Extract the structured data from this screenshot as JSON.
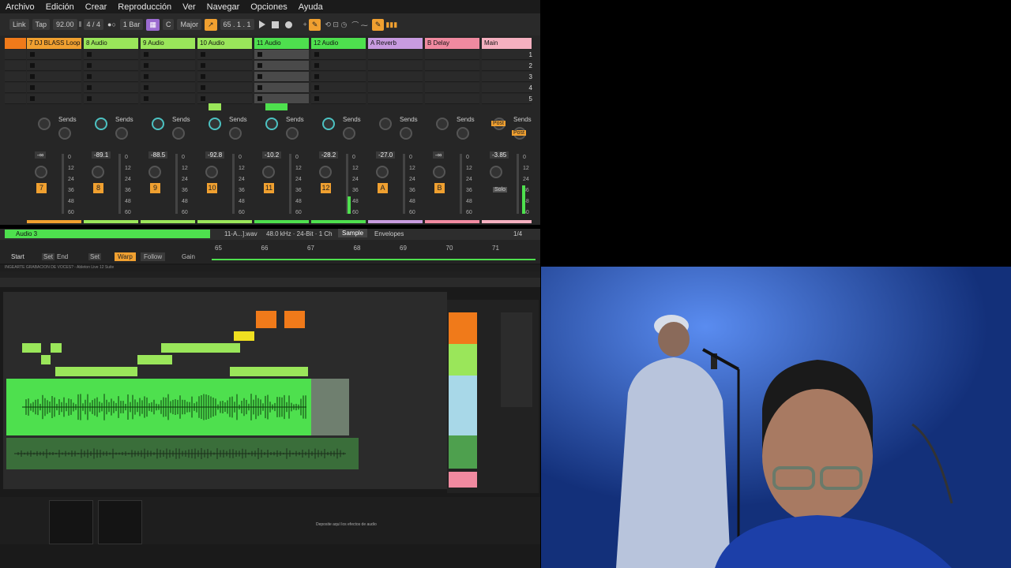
{
  "menu": [
    "Archivo",
    "Edición",
    "Crear",
    "Reproducción",
    "Ver",
    "Navegar",
    "Opciones",
    "Ayuda"
  ],
  "transport": {
    "link": "Link",
    "tap": "Tap",
    "tempo": "92.00",
    "signature": "4 / 4",
    "quantize": "1 Bar",
    "key": "C",
    "scale": "Major",
    "position": "65 .  1 .  1"
  },
  "tracks": [
    {
      "name": "",
      "color": "#f07a1a"
    },
    {
      "name": "7 DJ  BLASS  Loop",
      "color": "#f0a030",
      "num": "7",
      "vol": "-∞"
    },
    {
      "name": "8 Audio",
      "color": "#9ae65a",
      "num": "8",
      "vol": "-89.1"
    },
    {
      "name": "9 Audio",
      "color": "#9ae65a",
      "num": "9",
      "vol": "-88.5"
    },
    {
      "name": "10 Audio",
      "color": "#9ae65a",
      "num": "10",
      "vol": "-92.8"
    },
    {
      "name": "11 Audio",
      "color": "#4ee04e",
      "num": "11",
      "vol": "-10.2"
    },
    {
      "name": "12 Audio",
      "color": "#4ee04e",
      "num": "12",
      "vol": "-28.2"
    },
    {
      "name": "A Reverb",
      "color": "#c89be0",
      "num": "A",
      "vol": "-27.0"
    },
    {
      "name": "B Delay",
      "color": "#f08aa0",
      "num": "B",
      "vol": "-∞"
    },
    {
      "name": "Main",
      "color": "#f5b0c0",
      "num": "",
      "vol": "-3.85"
    }
  ],
  "scenes": [
    "1",
    "2",
    "3",
    "4",
    "5"
  ],
  "sends_label": "Sends",
  "send_a": "A",
  "send_b": "B",
  "post": "Post",
  "solo": "Solo",
  "scale_marks": [
    "0",
    "12",
    "24",
    "36",
    "48",
    "60"
  ],
  "clip": {
    "track": "Audio 3",
    "file": "11-A...].wav",
    "format": "48.0 kHz · 24-Bit · 1 Ch",
    "tab_sample": "Sample",
    "tab_envelopes": "Envelopes",
    "zoom": "1/4",
    "start": "Start",
    "set1": "Set",
    "end": "End",
    "set2": "Set",
    "warp": "Warp",
    "follow": "Follow",
    "gain": "Gain",
    "ruler": [
      "65",
      "66",
      "67",
      "68",
      "69",
      "70",
      "71"
    ]
  },
  "nested": {
    "window_title": "INGEARTE GRABACION DE VOCES? - Ableton Live 12 Suite",
    "drop_text": "Deposite aquí los efectos de audio"
  }
}
